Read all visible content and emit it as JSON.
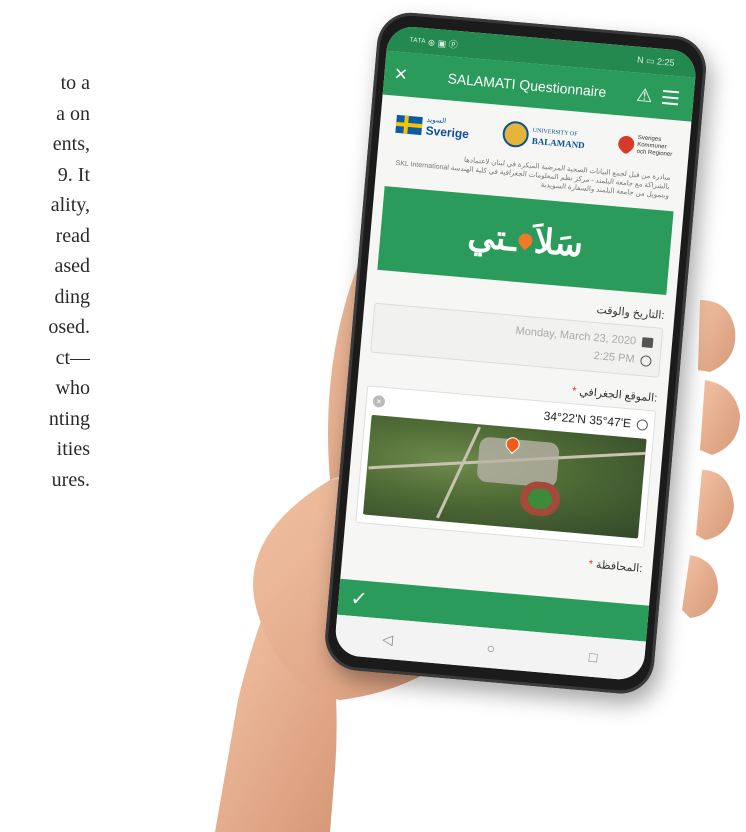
{
  "article": {
    "lines": [
      "to a",
      "a on",
      "ents,",
      "9. It",
      "ality,",
      "read",
      "ased",
      "ding",
      "osed.",
      "ct—",
      "who",
      "nting",
      "ities",
      "ures."
    ]
  },
  "phone": {
    "status": {
      "left": "ᵀᴬᵀᴬ ⊛ ▣ ⓟ",
      "right": "N ▭ 2:25"
    },
    "appbar": {
      "title": "SALAMATI Questionnaire",
      "close_icon": "×",
      "warning_icon": "⚠"
    },
    "logos": {
      "sweden_small": "السويد",
      "sweden": "Sverige",
      "univ_top": "UNIVERSITY OF",
      "univ": "BALAMAND",
      "skr": "Sveriges Kommuner och Regioner"
    },
    "partner_text": [
      "مبادرة من قبل لجمع البيانات الصحية المرضية المبكرة في لبنان لاعتمادها",
      "SKL International بالشراكة مع جامعة البلمند - مركز نظم المعلومات الجغرافية في كلية الهندسة",
      "وبتمويل من جامعة البلمند والسفارة السويدية"
    ],
    "banner_text_right": "سَلاَ",
    "banner_text_left": "ـتي",
    "date_label": "التاريخ والوقت:",
    "date_value": "Monday, March 23, 2020",
    "time_value": "2:25 PM",
    "location_label": "الموقع الجغرافي:",
    "required_mark": "*",
    "coordinates": "34°22'N 35°47'E",
    "governorate_label": "المحافظة:",
    "check_icon": "✓",
    "nav": {
      "back": "◁",
      "home": "○",
      "recent": "□"
    }
  },
  "colors": {
    "primary_green": "#2a9b5a",
    "status_green": "#23894f",
    "marker_orange": "#f05a1a"
  }
}
